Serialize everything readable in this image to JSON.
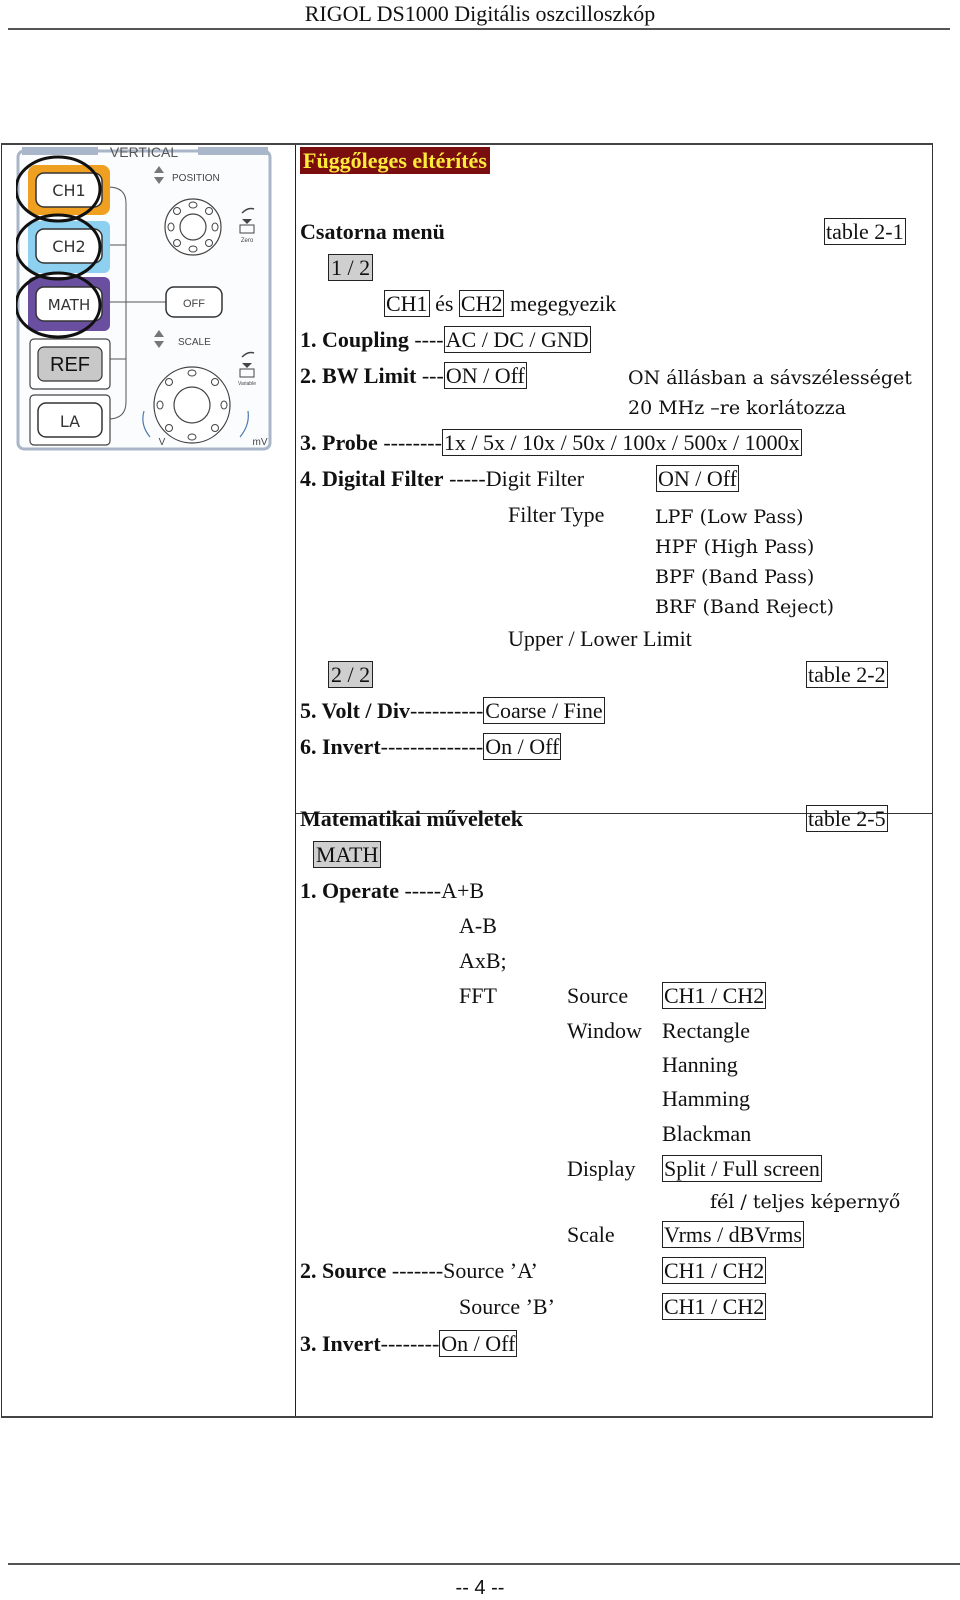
{
  "header": {
    "title": "RIGOL DS1000 Digitális oszcilloszkóp"
  },
  "footer": {
    "page": "-- 4 --"
  },
  "panel": {
    "heading": "VERTICAL",
    "buttons": {
      "ch1": "CH1",
      "ch2": "CH2",
      "math": "MATH",
      "ref": "REF",
      "la": "LA",
      "off": "OFF"
    },
    "labels": {
      "position": "POSITION",
      "scale": "SCALE",
      "v": "V",
      "mv": "mV",
      "zero": "Zero",
      "variable": "Variable"
    },
    "colors": {
      "ch1": "#f0a020",
      "ch2": "#8ed0f0",
      "math": "#6a4fa0",
      "ref": "#c8c8c8"
    }
  },
  "vertical": {
    "section_title": "Függőleges eltérítés",
    "channel_menu": {
      "title": "Csatorna menü",
      "table_ref": "table 2-1",
      "page1": "1 / 2",
      "ch1": "CH1",
      "es": "és",
      "ch2": "CH2",
      "same": "megegyezik",
      "coupling": {
        "label": "1. Coupling",
        "dashes": "----",
        "value": "AC / DC / GND"
      },
      "bw_limit": {
        "label": "2. BW Limit",
        "dashes": "---",
        "value": "ON / Off",
        "note1": "ON állásban a sávszélességet",
        "note2": "20 MHz –re korlátozza"
      },
      "probe": {
        "label": "3. Probe",
        "dashes": "--------",
        "value": "1x / 5x / 10x / 50x / 100x / 500x / 1000x"
      },
      "digital_filter": {
        "label": "4. Digital Filter",
        "dashes": "-----",
        "digit_filter": "Digit Filter",
        "digit_filter_value": "ON / Off",
        "filter_type": "Filter Type",
        "types": [
          "LPF (Low Pass)",
          "HPF (High Pass)",
          "BPF (Band Pass)",
          "BRF (Band Reject)"
        ],
        "limit": "Upper / Lower Limit"
      },
      "page2": "2 / 2",
      "table_ref2": "table 2-2",
      "volt_div": {
        "label": "5. Volt / Div",
        "dashes": "----------",
        "value": "Coarse / Fine"
      },
      "invert": {
        "label": "6. Invert",
        "dashes": "--------------",
        "value": "On / Off"
      }
    }
  },
  "math": {
    "title": "Matematikai műveletek",
    "table_ref": "table 2-5",
    "button": "MATH",
    "operate": {
      "label": "1. Operate",
      "dashes": "-----",
      "ops": [
        "A+B",
        "A-B",
        "AxB;",
        "FFT"
      ]
    },
    "fft": {
      "source_label": "Source",
      "source_value": "CH1 / CH2",
      "window_label": "Window",
      "windows": [
        "Rectangle",
        "Hanning",
        "Hamming",
        "Blackman"
      ],
      "display_label": "Display",
      "display_value": "Split / Full screen",
      "display_note": "fél / teljes képernyő",
      "scale_label": "Scale",
      "scale_value": "Vrms / dBVrms"
    },
    "source": {
      "label": "2. Source",
      "dashes": "-------",
      "a_label": "Source ’A’",
      "a_value": "CH1 / CH2",
      "b_label": "Source ’B’",
      "b_value": "CH1 / CH2"
    },
    "invert": {
      "label": "3. Invert",
      "dashes": "--------",
      "value": "On / Off"
    }
  }
}
